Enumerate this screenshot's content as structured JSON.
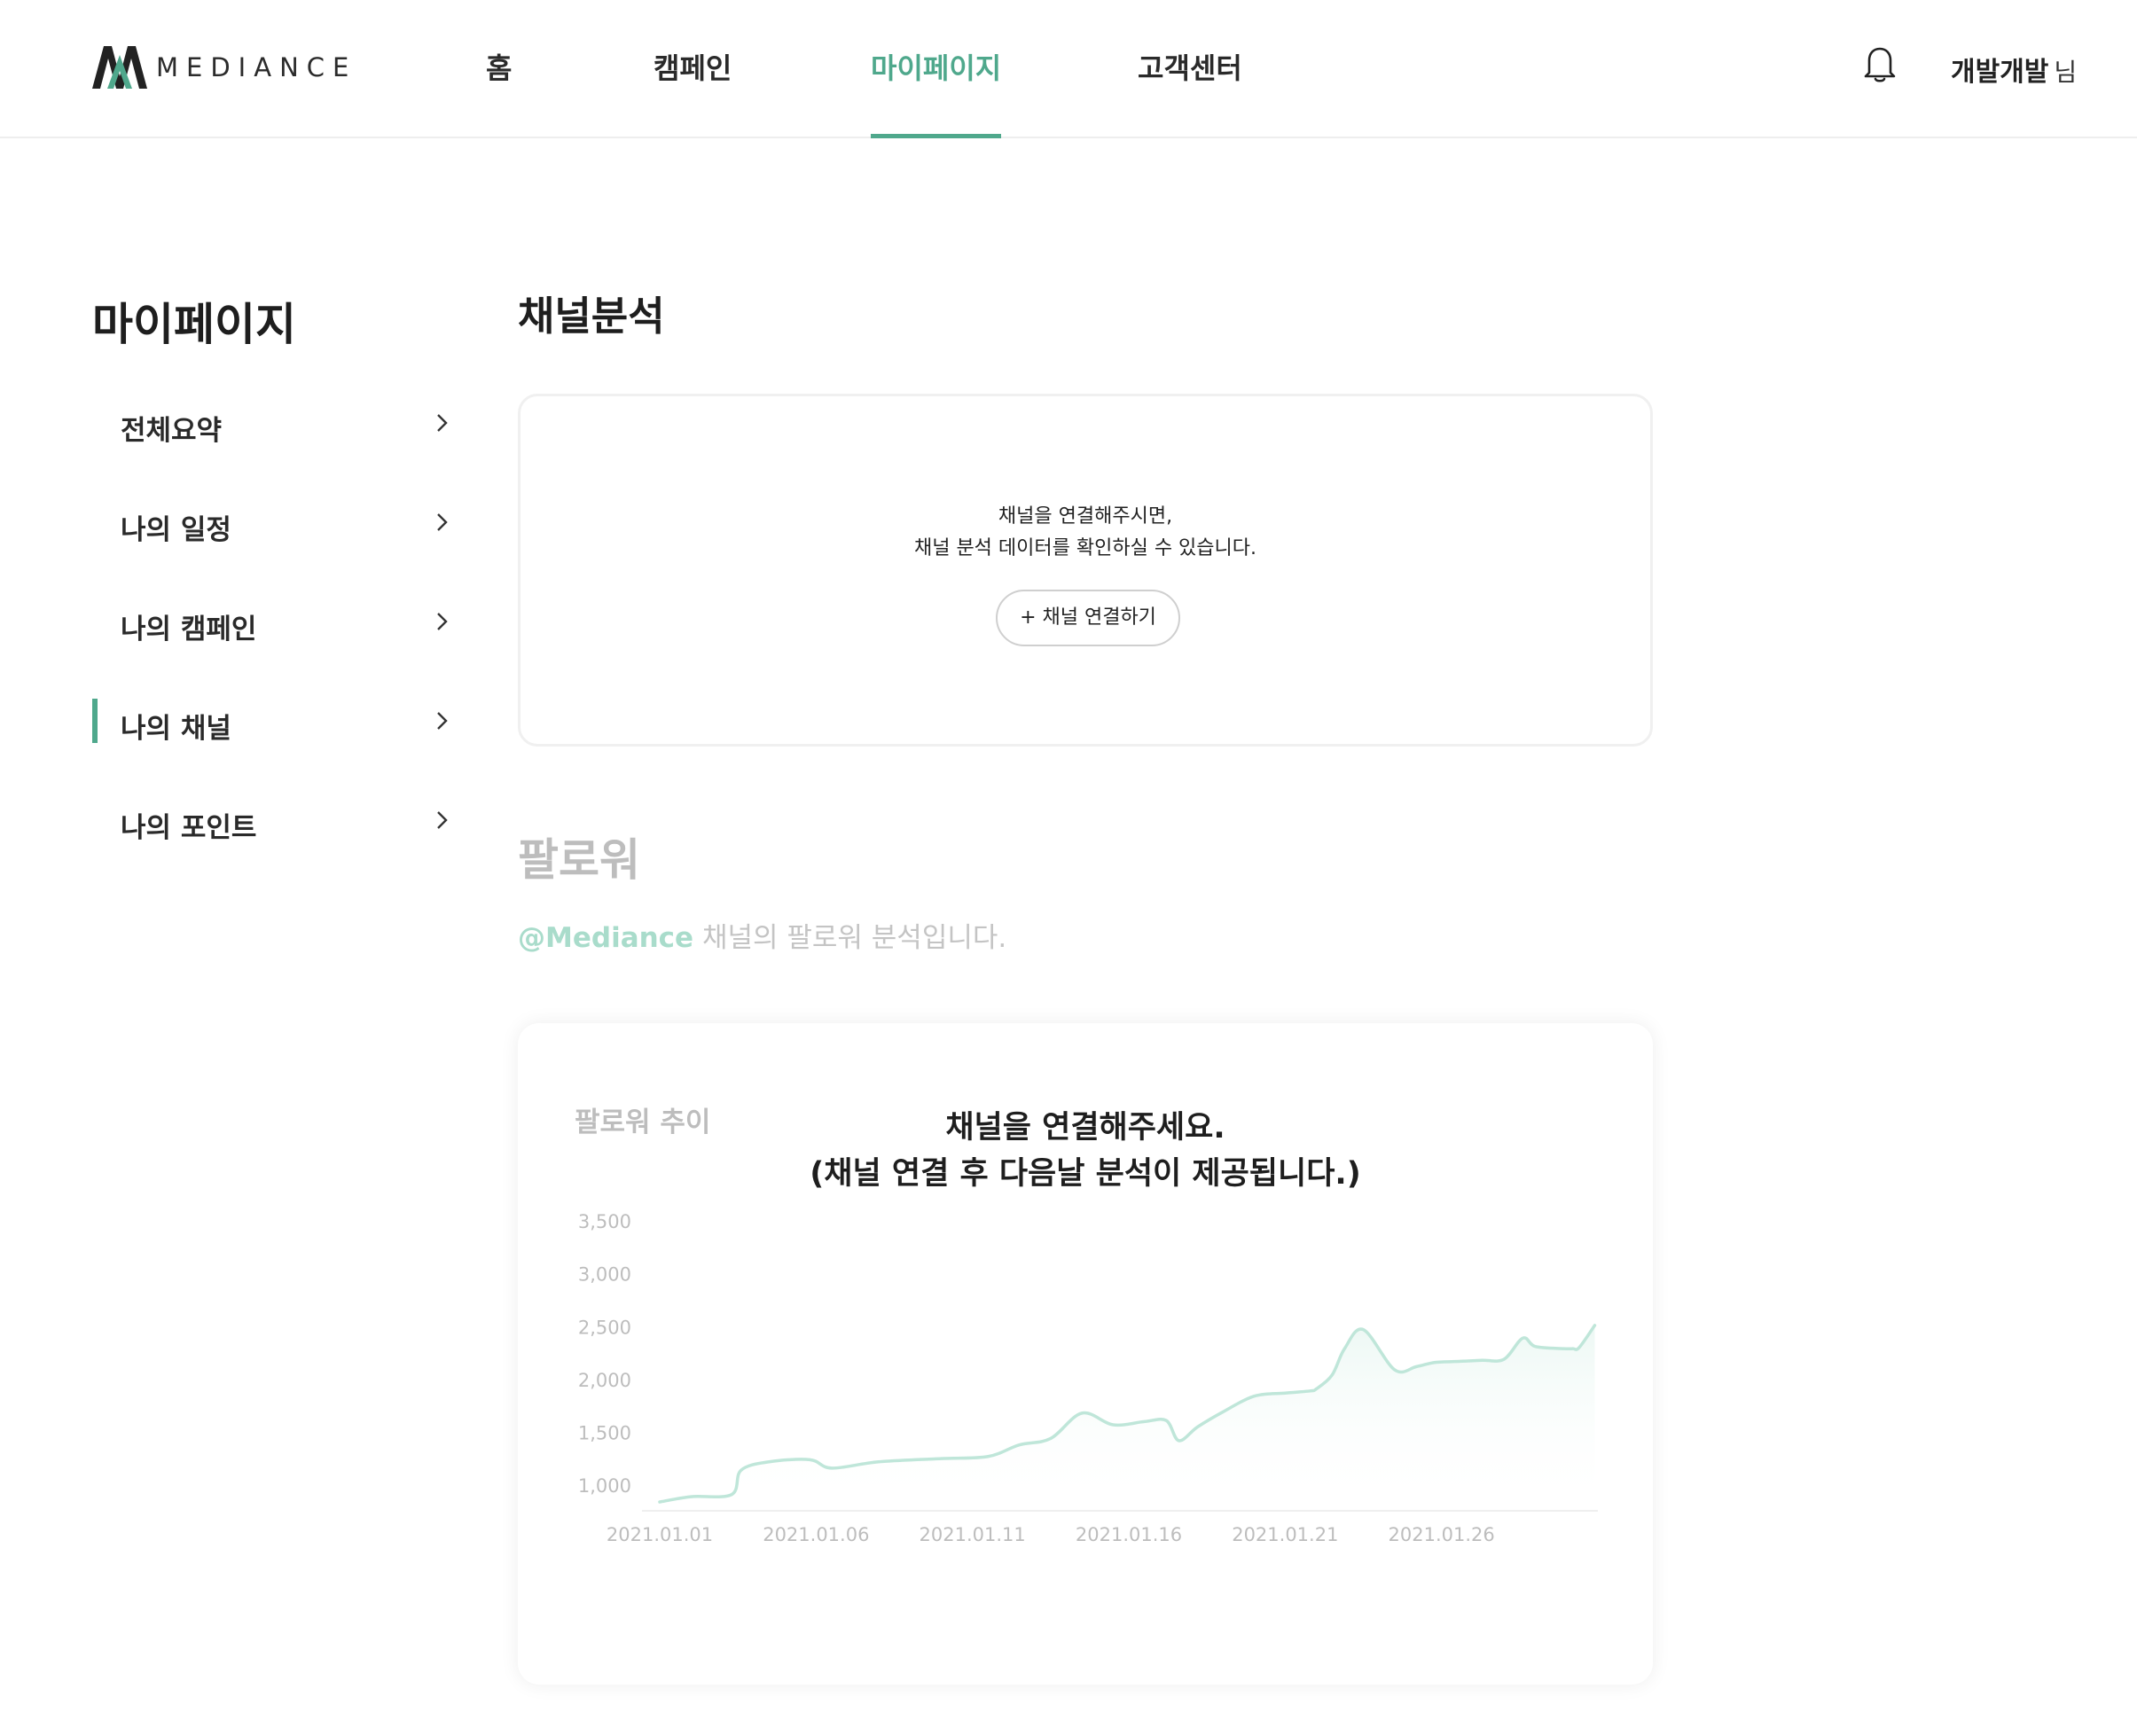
{
  "brand": {
    "logo_text": "MEDIANCE"
  },
  "nav": {
    "items": [
      {
        "label": "홈"
      },
      {
        "label": "캠페인"
      },
      {
        "label": "마이페이지"
      },
      {
        "label": "고객센터"
      }
    ],
    "active_index": 2
  },
  "user": {
    "name": "개발개발",
    "suffix": "님"
  },
  "sidebar": {
    "title": "마이페이지",
    "items": [
      {
        "label": "전체요약"
      },
      {
        "label": "나의 일정"
      },
      {
        "label": "나의 캠페인"
      },
      {
        "label": "나의 채널"
      },
      {
        "label": "나의 포인트"
      }
    ],
    "active_index": 3
  },
  "channel_analysis": {
    "title": "채널분석",
    "message_line1": "채널을 연결해주시면,",
    "message_line2": "채널 분석 데이터를 확인하실 수 있습니다.",
    "button_label": "+ 채널 연결하기"
  },
  "follower": {
    "title": "팔로워",
    "handle": "@Mediance",
    "description": "채널의 팔로워 분석입니다.",
    "chart_label": "팔로워 추이",
    "overlay_line1": "채널을 연결해주세요.",
    "overlay_line2": "(채널 연결 후 다음날 분석이 제공됩니다.)"
  },
  "colors": {
    "accent": "#4fa88c",
    "line": "#bfe6d9",
    "muted": "#bdbdbd"
  },
  "chart_data": {
    "type": "area",
    "title": "팔로워 추이",
    "xlabel": "",
    "ylabel": "",
    "ylim": [
      800,
      3500
    ],
    "yticks": [
      1000,
      1500,
      2000,
      2500,
      3000,
      3500
    ],
    "ytick_labels": [
      "1,000",
      "1,500",
      "2,000",
      "2,500",
      "3,000",
      "3,500"
    ],
    "xtick_labels": [
      "2021.01.01",
      "2021.01.06",
      "2021.01.11",
      "2021.01.16",
      "2021.01.21",
      "2021.01.26"
    ],
    "x_range": [
      1,
      31
    ],
    "x": [
      1,
      2,
      3.3,
      3.6,
      4.5,
      5.8,
      6.5,
      8,
      10,
      11.5,
      12.5,
      13.5,
      14.5,
      15.5,
      16.5,
      17.2,
      17.6,
      18.2,
      19,
      20,
      21,
      21.8,
      22,
      22.5,
      22.9,
      23.5,
      24.5,
      25.2,
      25.8,
      26.6,
      27.3,
      28,
      28.6,
      29,
      29.9,
      30.2,
      30.4,
      30.9
    ],
    "values": [
      850,
      900,
      920,
      1150,
      1230,
      1250,
      1170,
      1230,
      1260,
      1280,
      1390,
      1450,
      1690,
      1580,
      1610,
      1620,
      1430,
      1560,
      1700,
      1850,
      1880,
      1900,
      1920,
      2050,
      2300,
      2480,
      2100,
      2130,
      2170,
      2180,
      2190,
      2200,
      2400,
      2320,
      2300,
      2300,
      2310,
      2520
    ]
  }
}
